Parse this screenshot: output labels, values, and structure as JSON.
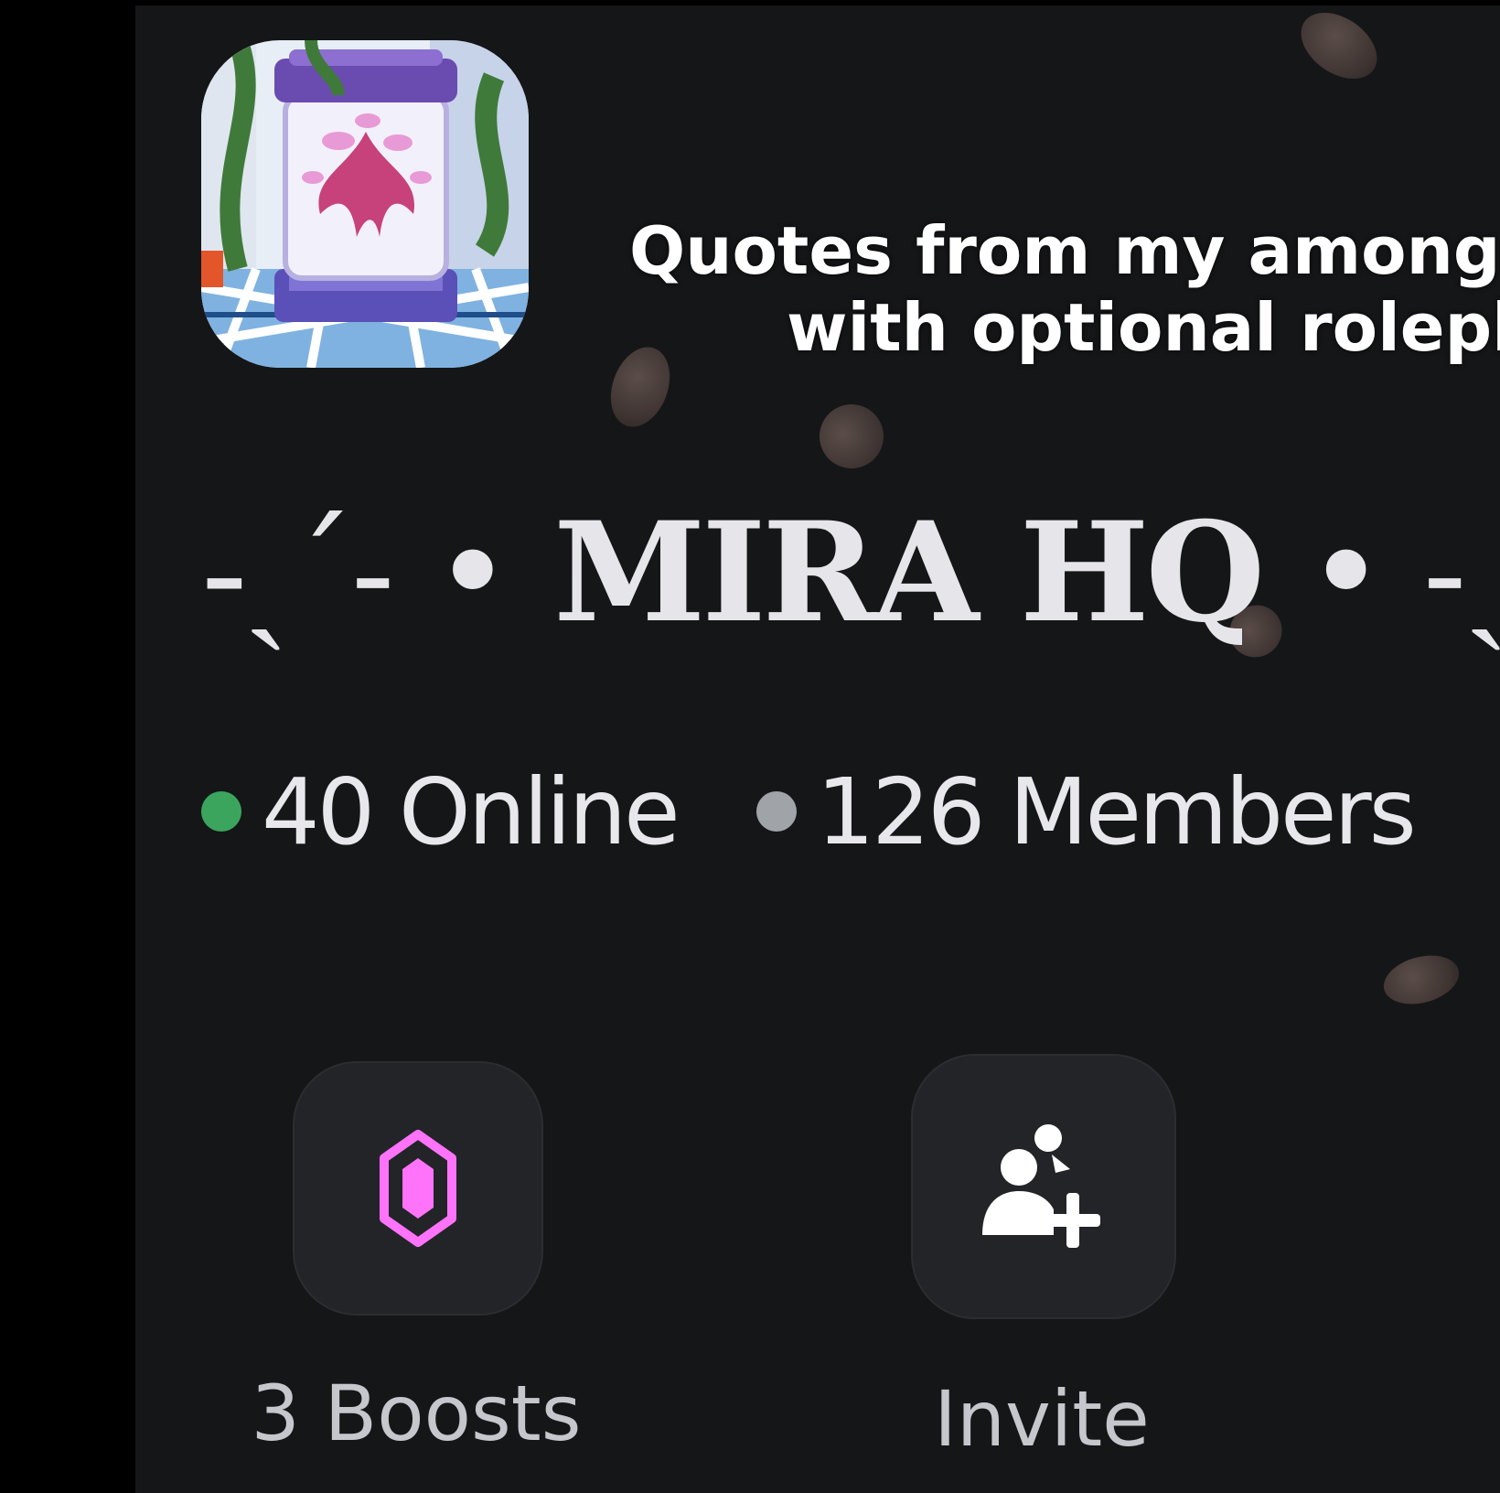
{
  "caption": {
    "line1": "Quotes from my among",
    "line2": "with optional rolepla"
  },
  "server": {
    "name": "MIRA HQ",
    "name_deco_left": "-ˎˊ˗ •",
    "name_deco_right": "• ˗ˏˋ-",
    "icon": "server-icon-specimen-jar"
  },
  "stats": {
    "online_label": "40 Online",
    "members_label": "126 Members",
    "online_color": "#3ba55d",
    "members_color": "#a0a3a8"
  },
  "actions": {
    "boosts_label": "3 Boosts",
    "invite_label": "Invite",
    "boost_icon": "boost-gem-icon",
    "invite_icon": "add-friend-icon",
    "boost_color": "#ff73fa"
  }
}
